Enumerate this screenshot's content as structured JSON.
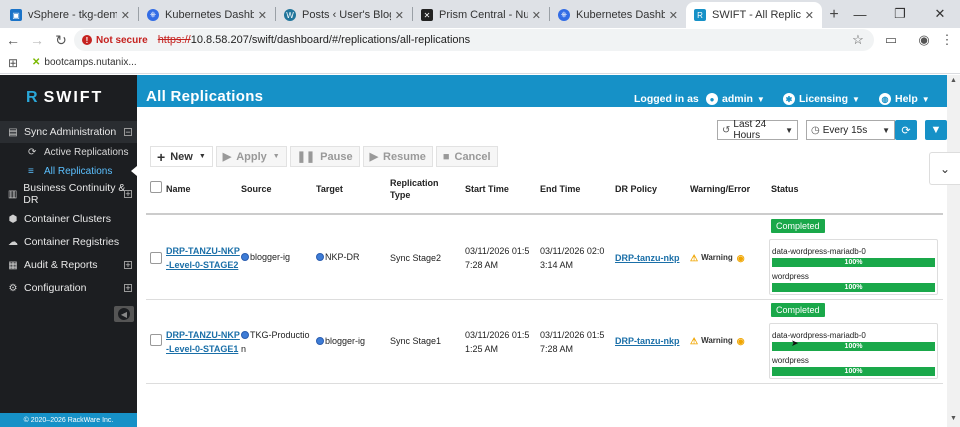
{
  "browser": {
    "tabs": [
      {
        "label": "vSphere - tkg-demo-cluster",
        "icon_color": "#1a73c8",
        "active": false
      },
      {
        "label": "Kubernetes Dashboard",
        "icon_color": "#326ce5",
        "active": false
      },
      {
        "label": "Posts ‹ User's Blog! — WordPress",
        "icon_color": "#21759b",
        "active": false
      },
      {
        "label": "Prism Central - Nutanix",
        "icon_color": "#222222",
        "active": false
      },
      {
        "label": "Kubernetes Dashboard",
        "icon_color": "#326ce5",
        "active": false
      },
      {
        "label": "SWIFT - All Replications",
        "icon_color": "#1691c7",
        "active": true
      }
    ],
    "not_secure": "Not secure",
    "url_scheme": "https://",
    "url_rest": "10.8.58.207/swift/dashboard/#/replications/all-replications",
    "bookmark": "bootcamps.nutanix..."
  },
  "app": {
    "logo": "SWIFT",
    "page_title": "All Replications",
    "header": {
      "logged_in": "Logged in as",
      "user": "admin",
      "licensing": "Licensing",
      "help": "Help"
    },
    "sidebar": {
      "sync_admin": "Sync Administration",
      "active_replications": "Active Replications",
      "all_replications": "All Replications",
      "business_continuity": "Business Continuity & DR",
      "container_clusters": "Container Clusters",
      "container_registries": "Container Registries",
      "audit_reports": "Audit & Reports",
      "configuration": "Configuration",
      "copyright": "© 2020–2026 RackWare Inc."
    },
    "filters": {
      "time_range": "Last 24 Hours",
      "refresh_interval": "Every 15s"
    },
    "toolbar": {
      "new": "New",
      "apply": "Apply",
      "pause": "Pause",
      "resume": "Resume",
      "cancel": "Cancel"
    },
    "table": {
      "headers": {
        "name": "Name",
        "source": "Source",
        "target": "Target",
        "replication_type_1": "Replication",
        "replication_type_2": "Type",
        "start_time": "Start Time",
        "end_time": "End Time",
        "dr_policy": "DR Policy",
        "warning_error": "Warning/Error",
        "status": "Status"
      },
      "rows": [
        {
          "name_1": "DRP-TANZU-NKP",
          "name_2": "-Level-0-STAGE2",
          "source_1": "blogger-ig",
          "source_2": "",
          "target": "NKP-DR",
          "type": "Sync Stage2",
          "start_1": "03/11/2026 01:5",
          "start_2": "7:28 AM",
          "end_1": "03/11/2026 02:0",
          "end_2": "3:14 AM",
          "policy": "DRP-tanzu-nkp",
          "warning": "Warning",
          "status": "Completed",
          "progress": [
            {
              "name": "data-wordpress-mariadb-0",
              "percent": 100,
              "label": "100%"
            },
            {
              "name": "wordpress",
              "percent": 100,
              "label": "100%"
            }
          ]
        },
        {
          "name_1": "DRP-TANZU-NKP",
          "name_2": "-Level-0-STAGE1",
          "source_1": "TKG-Productio",
          "source_2": "n",
          "target": "blogger-ig",
          "type": "Sync Stage1",
          "start_1": "03/11/2026 01:5",
          "start_2": "1:25 AM",
          "end_1": "03/11/2026 01:5",
          "end_2": "7:28 AM",
          "policy": "DRP-tanzu-nkp",
          "warning": "Warning",
          "status": "Completed",
          "progress": [
            {
              "name": "data-wordpress-mariadb-0",
              "percent": 100,
              "label": "100%"
            },
            {
              "name": "wordpress",
              "percent": 100,
              "label": "100%"
            }
          ]
        }
      ]
    }
  }
}
